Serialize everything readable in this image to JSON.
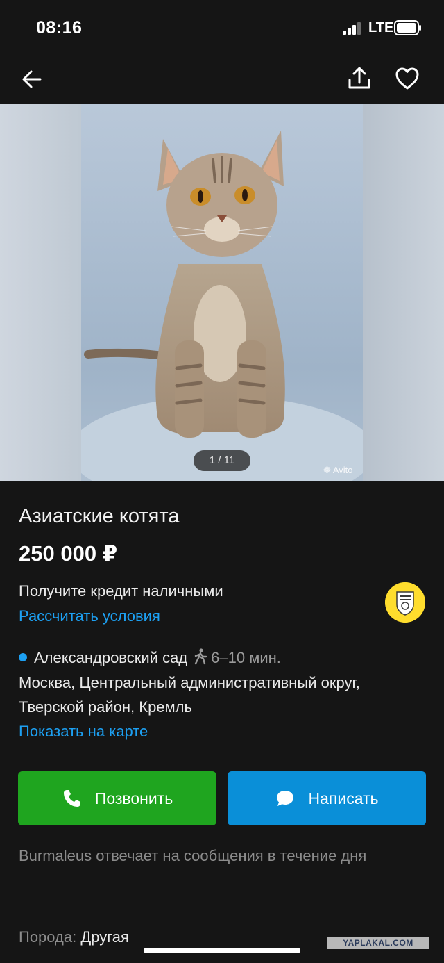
{
  "status_bar": {
    "time": "08:16",
    "network": "LTE"
  },
  "nav": {
    "back_icon": "arrow-left-icon",
    "share_icon": "share-icon",
    "favorite_icon": "heart-icon"
  },
  "gallery": {
    "counter": "1 / 11",
    "watermark": "Avito",
    "current_index": 1,
    "total": 11
  },
  "listing": {
    "title": "Азиатские котята",
    "price": "250 000 ₽"
  },
  "credit": {
    "text": "Получите кредит наличными",
    "link": "Рассчитать условия",
    "logo_icon": "bank-emblem-icon"
  },
  "location": {
    "metro_station": "Александровский сад",
    "metro_time": "6–10 мин.",
    "address_line1": "Москва, Центральный административный округ,",
    "address_line2": "Тверской район, Кремль",
    "map_link": "Показать на карте"
  },
  "actions": {
    "call_label": "Позвонить",
    "write_label": "Написать"
  },
  "seller_note": "Burmaleus отвечает на сообщения в течение дня",
  "params": {
    "breed_label": "Порода:",
    "breed_value": "Другая"
  },
  "watermark_site": "YAPLAKAL.COM",
  "colors": {
    "background": "#151515",
    "link": "#1da0f2",
    "call_button": "#1fa51f",
    "write_button": "#0a8fd8",
    "bank_logo": "#ffdd2d"
  }
}
